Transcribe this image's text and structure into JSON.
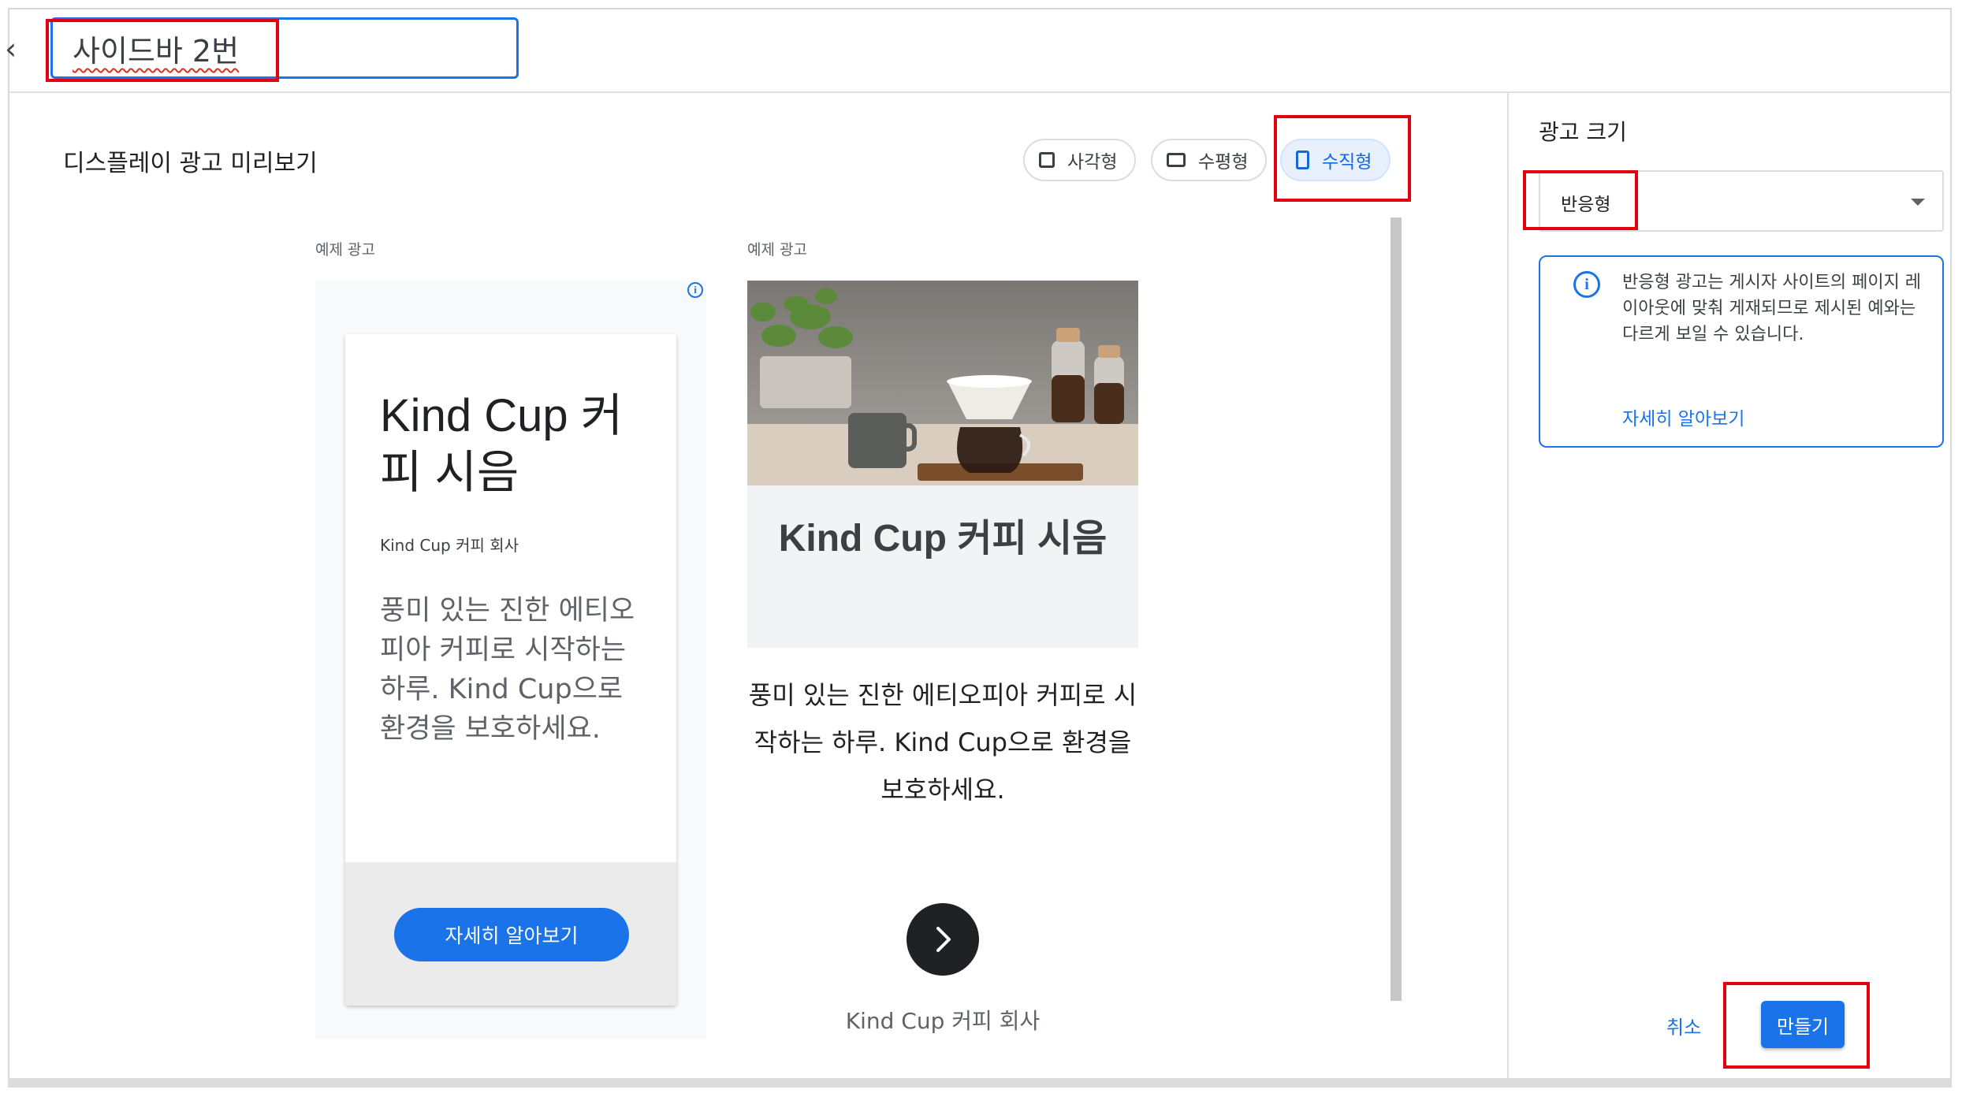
{
  "header": {
    "back_glyph": "‹",
    "ad_name_value": "사이드바 2번"
  },
  "preview": {
    "title": "디스플레이 광고 미리보기",
    "shape_options": [
      {
        "label": "사각형",
        "selected": false
      },
      {
        "label": "수평형",
        "selected": false
      },
      {
        "label": "수직형",
        "selected": true
      }
    ],
    "sample_label": "예제 광고"
  },
  "ad1": {
    "info_icon": "i",
    "headline": "Kind Cup 커피 시음",
    "company": "Kind Cup 커피 회사",
    "body": "풍미 있는 진한 에티오피아 커피로 시작하는 하루. Kind Cup으로 환경을 보호하세요.",
    "cta_label": "자세히 알아보기"
  },
  "ad2": {
    "image_alt": "coffee-dripper-photo",
    "headline": "Kind Cup 커피 시음",
    "body": "풍미 있는 진한 에티오피아 커피로 시작하는 하루. Kind Cup으로 환경을 보호하세요.",
    "company": "Kind Cup 커피 회사"
  },
  "right_panel": {
    "size_title": "광고 크기",
    "size_select_value": "반응형",
    "notice_icon": "i",
    "notice_text": "반응형 광고는 게시자 사이트의 페이지 레이아웃에 맞춰 게재되므로 제시된 예와는 다르게 보일 수 있습니다.",
    "notice_link": "자세히 알아보기",
    "cancel_label": "취소",
    "create_label": "만들기"
  },
  "colors": {
    "accent": "#1a73e8",
    "annotation_red": "#e3000f",
    "chip_selected_bg": "#e8f0fe"
  }
}
